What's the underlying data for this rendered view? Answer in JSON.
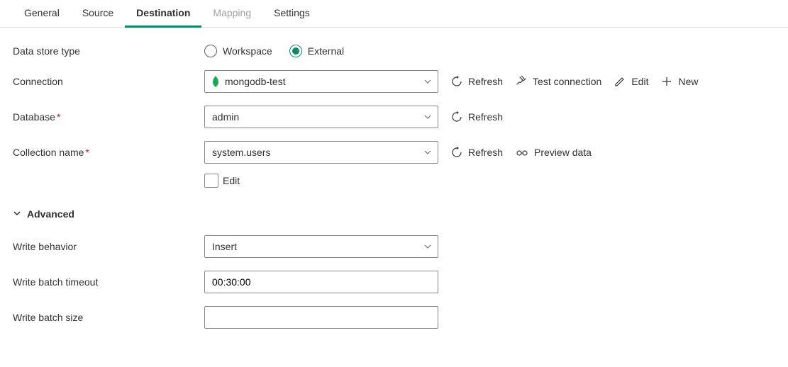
{
  "tabs": {
    "general": "General",
    "source": "Source",
    "destination": "Destination",
    "mapping": "Mapping",
    "settings": "Settings"
  },
  "labels": {
    "data_store_type": "Data store type",
    "connection": "Connection",
    "database": "Database",
    "collection_name": "Collection name",
    "advanced": "Advanced",
    "write_behavior": "Write behavior",
    "write_batch_timeout": "Write batch timeout",
    "write_batch_size": "Write batch size",
    "edit_checkbox": "Edit"
  },
  "radio": {
    "workspace": "Workspace",
    "external": "External"
  },
  "values": {
    "connection": "mongodb-test",
    "database": "admin",
    "collection": "system.users",
    "write_behavior": "Insert",
    "write_batch_timeout": "00:30:00",
    "write_batch_size": ""
  },
  "actions": {
    "refresh": "Refresh",
    "test_connection": "Test connection",
    "edit": "Edit",
    "new": "New",
    "preview_data": "Preview data"
  }
}
